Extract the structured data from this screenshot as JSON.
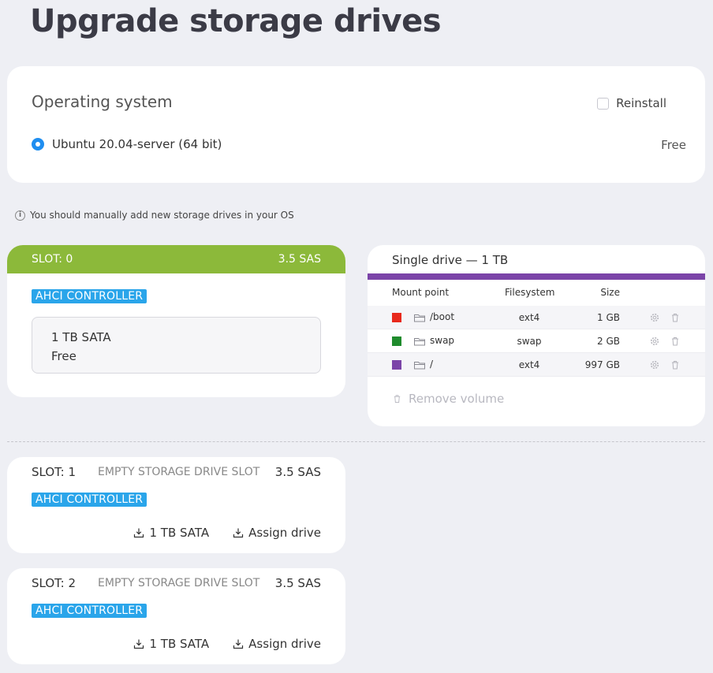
{
  "page": {
    "title": "Upgrade storage drives"
  },
  "os": {
    "title": "Operating system",
    "reinstall_label": "Reinstall",
    "option_label": "Ubuntu 20.04-server (64 bit)",
    "price": "Free"
  },
  "notice": "You should manually add new storage drives in your OS",
  "slot0": {
    "slot_label": "SLOT: 0",
    "type": "3.5 SAS",
    "controller": "AHCI CONTROLLER",
    "drive_name": "1 TB SATA",
    "drive_price": "Free",
    "header_color": "#8cb93a"
  },
  "drive_panel": {
    "title": "Single drive — 1 TB",
    "bar_color": "#7b44a8",
    "columns": {
      "mount": "Mount point",
      "fs": "Filesystem",
      "size": "Size"
    },
    "rows": [
      {
        "mount": "/boot",
        "fs": "ext4",
        "size": "1 GB",
        "color": "#e8291c"
      },
      {
        "mount": "swap",
        "fs": "swap",
        "size": "2 GB",
        "color": "#1f8b2d"
      },
      {
        "mount": "/",
        "fs": "ext4",
        "size": "997 GB",
        "color": "#7b44a8"
      }
    ],
    "remove_label": "Remove volume"
  },
  "empty_slots": [
    {
      "slot_label": "SLOT: 1",
      "status": "EMPTY STORAGE DRIVE SLOT",
      "type": "3.5 SAS",
      "controller": "AHCI CONTROLLER",
      "drive_option": "1 TB SATA",
      "assign_label": "Assign drive"
    },
    {
      "slot_label": "SLOT: 2",
      "status": "EMPTY STORAGE DRIVE SLOT",
      "type": "3.5 SAS",
      "controller": "AHCI CONTROLLER",
      "drive_option": "1 TB SATA",
      "assign_label": "Assign drive"
    }
  ]
}
